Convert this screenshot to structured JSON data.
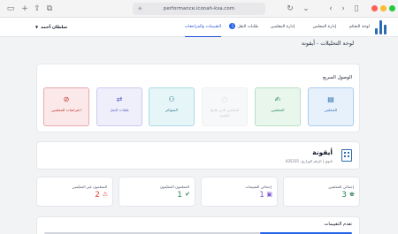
{
  "browser": {
    "url": "performance.iconah-ksa.com"
  },
  "header": {
    "nav": [
      {
        "label": "لوحة التحكم"
      },
      {
        "label": "إدارة المجلس"
      },
      {
        "label": "إدارة المعلمين"
      },
      {
        "label": "طلبات النقل",
        "badge": "1"
      },
      {
        "label": "التقييمات والمراجعات"
      }
    ],
    "user_name": "سلطان أحمد"
  },
  "page": {
    "title": "لوحة التحليلات - أيقونة"
  },
  "quick_access": {
    "title": "الوصول السريع",
    "tiles": [
      {
        "label": "المجلس",
        "icon": "building-icon"
      },
      {
        "label": "المعلمين",
        "icon": "teacher-icon"
      },
      {
        "label": "المعلمين الذين قاموا بالتقييم",
        "icon": "clipboard-icon"
      },
      {
        "label": "الشواغر",
        "icon": "vacancy-icon"
      },
      {
        "label": "طلبات النقل",
        "icon": "transfer-icon"
      },
      {
        "label": "اعتراضات المعلمين",
        "icon": "alert-icon"
      }
    ]
  },
  "company": {
    "name": "أيقونة",
    "subtitle": "ثانوي | الرقم الوزاري: 435315"
  },
  "stats": [
    {
      "label": "إجمالي المعلمين",
      "value": "3",
      "icon": "teachers-icon"
    },
    {
      "label": "إجمالي التقييمات",
      "value": "1",
      "icon": "document-icon"
    },
    {
      "label": "المعلمون المقيّمون",
      "value": "1",
      "icon": "check-user-icon"
    },
    {
      "label": "المعلمون غير المقيّمين",
      "value": "2",
      "icon": "warning-icon"
    }
  ],
  "progress": {
    "title": "تقدم التقييمات",
    "fraction": 0.3
  }
}
